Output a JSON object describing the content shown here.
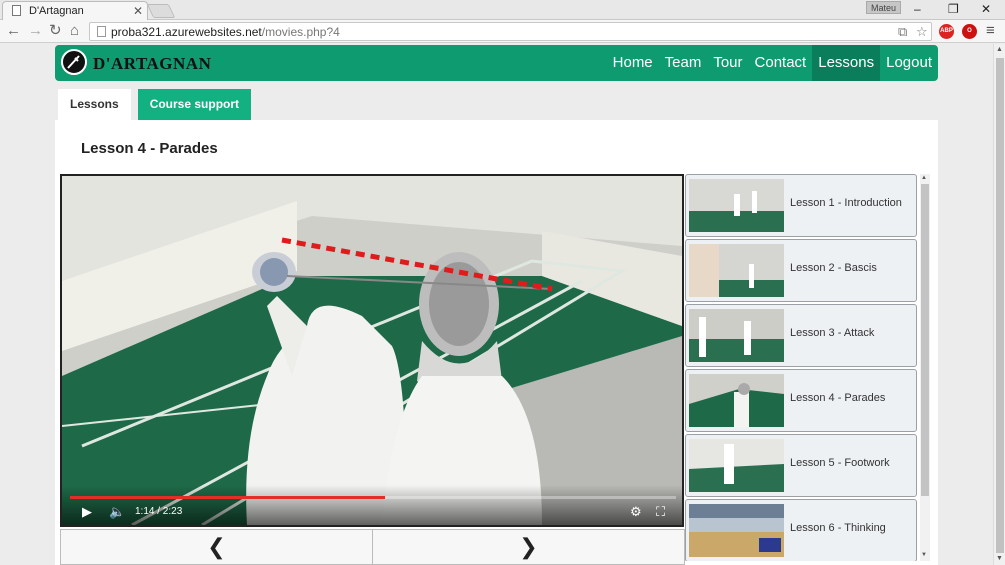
{
  "browser": {
    "tab_title": "D'Artagnan",
    "user_badge": "Mateu",
    "url_host": "proba321.azurewebsites.net",
    "url_path": "/movies.php?4",
    "ext_abp": "ABP"
  },
  "site": {
    "brand": "D'ARTAGNAN",
    "nav": [
      {
        "label": "Home"
      },
      {
        "label": "Team"
      },
      {
        "label": "Tour"
      },
      {
        "label": "Contact"
      },
      {
        "label": "Lessons",
        "active": true
      },
      {
        "label": "Logout"
      }
    ],
    "accent": "#0e9b6f"
  },
  "subtabs": {
    "lessons": "Lessons",
    "course_support": "Course support"
  },
  "lesson": {
    "title": "Lesson 4 - Parades",
    "current_time": "1:14 / 2:23",
    "progress_fraction": 0.52,
    "prev_glyph": "❮",
    "next_glyph": "❯"
  },
  "lessons": [
    {
      "label": "Lesson 1 - Introduction"
    },
    {
      "label": "Lesson 2 - Bascis"
    },
    {
      "label": "Lesson 3 - Attack"
    },
    {
      "label": "Lesson 4 - Parades"
    },
    {
      "label": "Lesson 5 - Footwork"
    },
    {
      "label": "Lesson 6 - Thinking"
    }
  ]
}
